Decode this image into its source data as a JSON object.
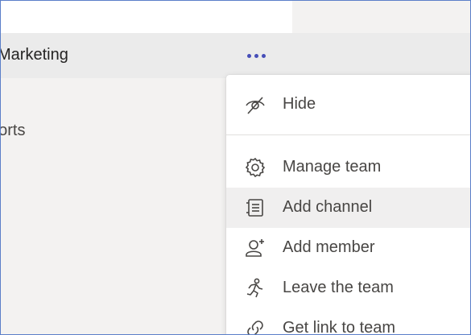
{
  "team_row": {
    "name": "Marketing",
    "more_icon": "more-dots-icon"
  },
  "channel_list": {
    "item": "Reports",
    "visible_text": "ports"
  },
  "menu": {
    "items": [
      {
        "label": "Hide",
        "icon": "eye-off-icon"
      },
      {
        "label": "Manage team",
        "icon": "gear-icon"
      },
      {
        "label": "Add channel",
        "icon": "list-icon"
      },
      {
        "label": "Add member",
        "icon": "add-person-icon"
      },
      {
        "label": "Leave the team",
        "icon": "running-person-icon"
      },
      {
        "label": "Get link to team",
        "icon": "link-icon"
      }
    ]
  },
  "colors": {
    "accent": "#464eb8",
    "frame_border": "#5b7fc9",
    "hover_bg": "#f0efef"
  }
}
